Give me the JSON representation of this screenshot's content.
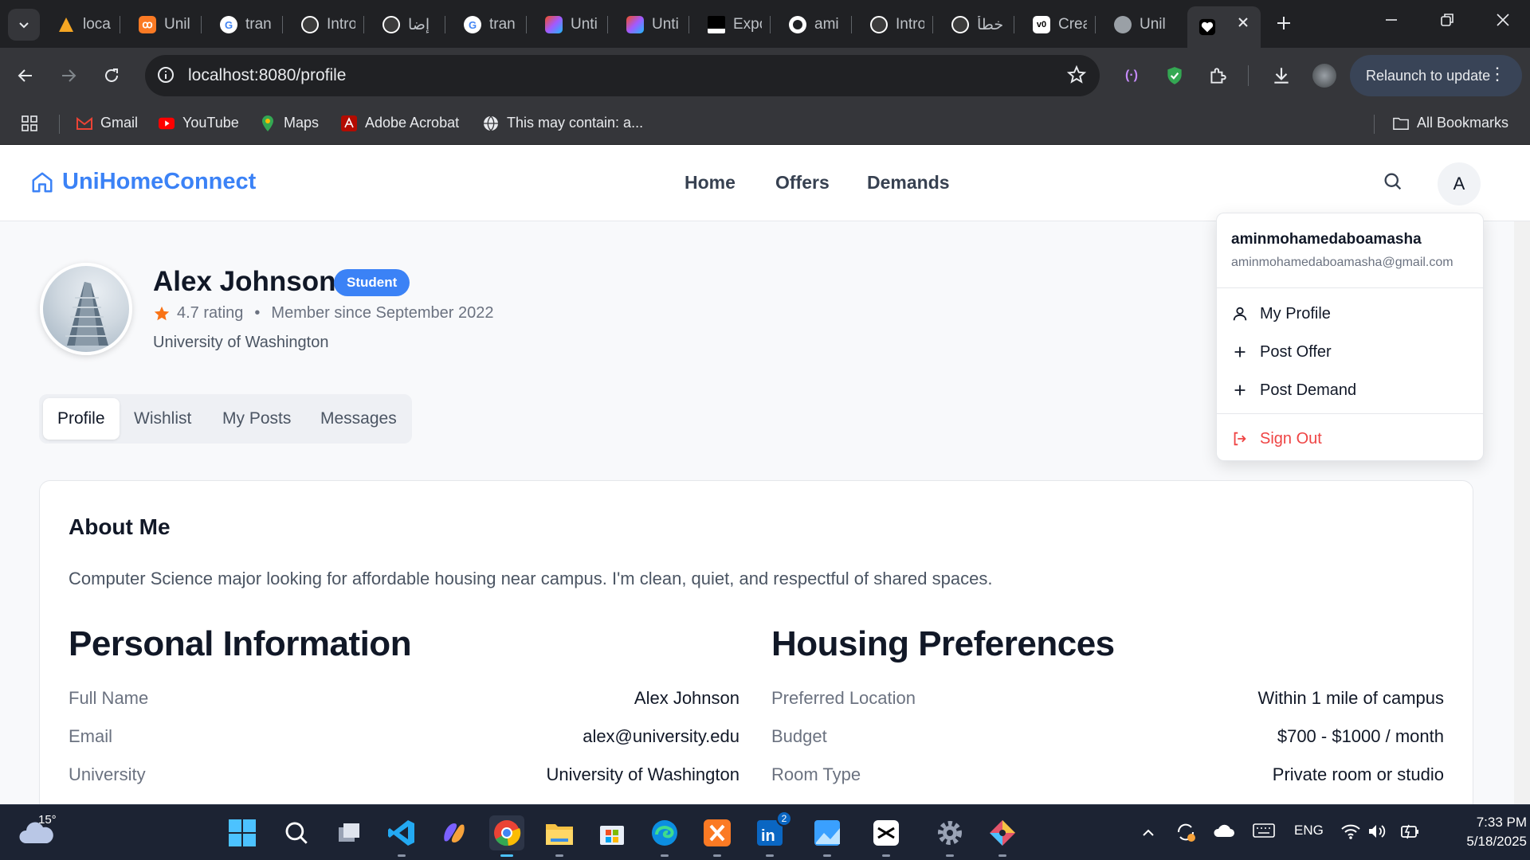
{
  "browser": {
    "tabs": [
      {
        "label": "loca",
        "icon": "vite-icon",
        "color": "#f5a623"
      },
      {
        "label": "Unil",
        "icon": "xampp-icon",
        "color": "#fb7a24"
      },
      {
        "label": "tran",
        "icon": "google-icon",
        "color": "#ffffff"
      },
      {
        "label": "Intro",
        "icon": "chatgpt-icon",
        "color": "#ffffff"
      },
      {
        "label": "إضا",
        "icon": "chatgpt-icon",
        "color": "#ffffff"
      },
      {
        "label": "tran",
        "icon": "google-icon",
        "color": "#ffffff"
      },
      {
        "label": "Unti",
        "icon": "figma-icon",
        "color": "#a259ff"
      },
      {
        "label": "Unti",
        "icon": "figma-icon",
        "color": "#a259ff"
      },
      {
        "label": "Expo",
        "icon": "unsplash-icon",
        "color": "#ffffff"
      },
      {
        "label": "ami",
        "icon": "github-icon",
        "color": "#ffffff"
      },
      {
        "label": "Intro",
        "icon": "chatgpt-icon",
        "color": "#ffffff"
      },
      {
        "label": "خطأ",
        "icon": "chatgpt-icon",
        "color": "#ffffff"
      },
      {
        "label": "Crea",
        "icon": "vercel-v0-icon",
        "color": "#ffffff"
      },
      {
        "label": "Unil",
        "icon": "globe-icon",
        "color": "#9aa0a6"
      }
    ],
    "active_tab_icon": "heart-icon",
    "url": "localhost:8080/profile",
    "relaunch_label": "Relaunch to update",
    "bookmarks": [
      {
        "label": "Gmail",
        "icon": "gmail-icon"
      },
      {
        "label": "YouTube",
        "icon": "youtube-icon"
      },
      {
        "label": "Maps",
        "icon": "maps-icon"
      },
      {
        "label": "Adobe Acrobat",
        "icon": "acrobat-icon"
      },
      {
        "label": "This may contain: a...",
        "icon": "globe-icon"
      }
    ],
    "all_bookmarks_label": "All Bookmarks"
  },
  "site": {
    "brand": "UniHomeConnect",
    "nav": [
      "Home",
      "Offers",
      "Demands"
    ],
    "avatar_initial": "A"
  },
  "profile": {
    "name": "Alex Johnson",
    "role": "Student",
    "rating": "4.7 rating",
    "separator": "•",
    "member_since": "Member since September 2022",
    "university": "University of Washington",
    "tabs": [
      "Profile",
      "Wishlist",
      "My Posts",
      "Messages"
    ],
    "active_tab": "Profile"
  },
  "about": {
    "title": "About Me",
    "text": "Computer Science major looking for affordable housing near campus. I'm clean, quiet, and respectful of shared spaces."
  },
  "personal_info": {
    "title": "Personal Information",
    "rows": [
      {
        "label": "Full Name",
        "value": "Alex Johnson"
      },
      {
        "label": "Email",
        "value": "alex@university.edu"
      },
      {
        "label": "University",
        "value": "University of Washington"
      }
    ]
  },
  "housing_prefs": {
    "title": "Housing Preferences",
    "rows": [
      {
        "label": "Preferred Location",
        "value": "Within 1 mile of campus"
      },
      {
        "label": "Budget",
        "value": "$700 - $1000 / month"
      },
      {
        "label": "Room Type",
        "value": "Private room or studio"
      }
    ]
  },
  "user_menu": {
    "username": "aminmohamedaboamasha",
    "email": "aminmohamedaboamasha@gmail.com",
    "items": [
      "My Profile",
      "Post Offer",
      "Post Demand"
    ],
    "sign_out": "Sign Out"
  },
  "taskbar": {
    "weather_temp": "15°",
    "language": "ENG",
    "time": "7:33 PM",
    "date": "5/18/2025",
    "linkedin_badge": "2"
  },
  "colors": {
    "accent": "#3b82f6",
    "danger": "#ef4444",
    "rating_star": "#f97316"
  }
}
